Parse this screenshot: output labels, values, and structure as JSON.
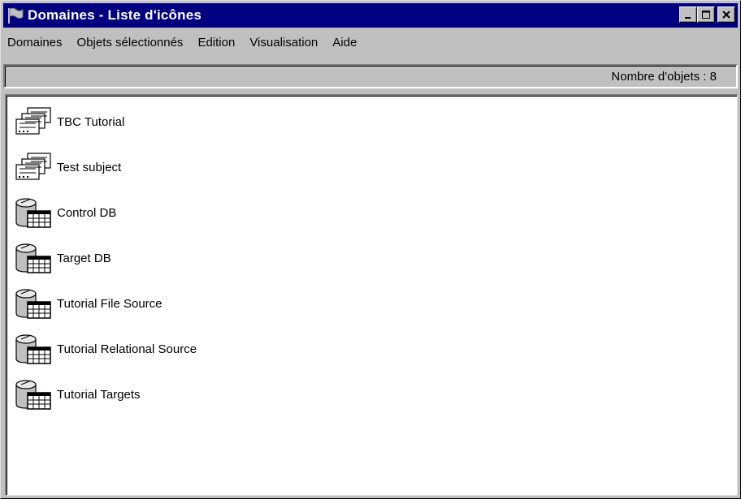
{
  "window": {
    "title": "Domaines - Liste d'icônes",
    "title_icon": "flag-icon",
    "controls": [
      {
        "name": "minimize-button",
        "symbol": "_"
      },
      {
        "name": "maximize-button",
        "symbol": "□"
      },
      {
        "name": "close-button",
        "symbol": "✕"
      }
    ]
  },
  "menu": {
    "items": [
      "Domaines",
      "Objets sélectionnés",
      "Edition",
      "Visualisation",
      "Aide"
    ]
  },
  "status": {
    "object_count": "Nombre d'objets : 8"
  },
  "list": {
    "items": [
      {
        "label": "TBC Tutorial",
        "icon": "stacked-documents-icon"
      },
      {
        "label": "Test subject",
        "icon": "stacked-documents-icon"
      },
      {
        "label": "Control DB",
        "icon": "database-table-icon"
      },
      {
        "label": "Target DB",
        "icon": "database-table-icon"
      },
      {
        "label": "Tutorial File Source",
        "icon": "database-table-icon"
      },
      {
        "label": "Tutorial Relational Source",
        "icon": "database-table-icon"
      },
      {
        "label": "Tutorial Targets",
        "icon": "database-table-icon"
      }
    ]
  },
  "colors": {
    "titlebar": "#000080",
    "face": "#c0c0c0",
    "list_background": "#ffffff"
  }
}
